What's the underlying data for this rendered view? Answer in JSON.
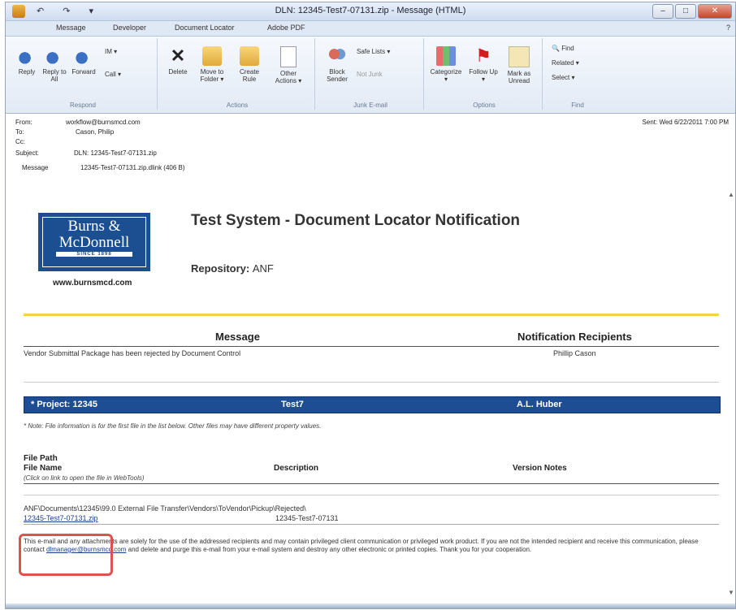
{
  "window": {
    "title": "DLN: 12345-Test7-07131.zip - Message (HTML)",
    "qat": "↶ ↷ ▾"
  },
  "ribbon_tabs": [
    "Message",
    "Developer",
    "Document Locator",
    "Adobe PDF"
  ],
  "ribbon": {
    "respond": {
      "reply": "Reply",
      "reply_all": "Reply to All",
      "forward": "Forward",
      "im": "IM ▾",
      "call": "Call ▾",
      "group": "Respond"
    },
    "actions": {
      "delete": "Delete",
      "move_to_folder": "Move to Folder ▾",
      "create_rule": "Create Rule",
      "other_actions": "Other Actions ▾",
      "group": "Actions"
    },
    "junk": {
      "block_sender": "Block Sender",
      "safe_lists": "Safe Lists ▾",
      "not_junk": "Not Junk",
      "group": "Junk E-mail"
    },
    "options": {
      "categorize": "Categorize ▾",
      "follow_up": "Follow Up ▾",
      "mark_unread": "Mark as Unread",
      "group": "Options"
    },
    "find": {
      "find": "Find",
      "related": "Related ▾",
      "select": "Select ▾",
      "group": "Find"
    }
  },
  "header": {
    "from_label": "From:",
    "from": "workflow@burnsmcd.com",
    "to_label": "To:",
    "to": "Cason, Philip",
    "cc_label": "Cc:",
    "cc": "",
    "subject_label": "Subject:",
    "subject": "DLN: 12345-Test7-07131.zip",
    "message_label": "Message",
    "attachment": "12345-Test7-07131.zip.dlink (406 B)",
    "sent": "Sent:   Wed 6/22/2011 7:00 PM"
  },
  "email": {
    "logo_line1": "Burns &",
    "logo_line2": "McDonnell",
    "logo_since": "SINCE 1898",
    "website": "www.burnsmcd.com",
    "notification_title": "Test System - Document Locator Notification",
    "repository_label": "Repository:",
    "repository": "ANF",
    "message_heading": "Message",
    "recipients_heading": "Notification Recipients",
    "message_text": "Vendor Submittal Package has been rejected by Document Control",
    "recipient": "Phillip Cason",
    "project_label": "* Project: 12345",
    "project_name": "Test7",
    "project_person": "A.L. Huber",
    "note": "* Note: File information is for the first file in the list below. Other files may have different property values.",
    "file_path_heading": "File Path",
    "file_name_heading": "File Name",
    "description_heading": "Description",
    "version_notes_heading": "Version Notes",
    "click_hint": "(Click on link to open the file in WebTools)",
    "file_path": "ANF\\Documents\\12345\\99.0 External File Transfer\\Vendors\\ToVendor\\Pickup\\Rejected\\",
    "file_name": "12345-Test7-07131.zip",
    "file_description": "12345-Test7-07131",
    "disclaimer_1": "This e-mail and any attachments are solely for the use of the addressed recipients and may contain privileged client communication or privileged work product. If you are not the intended recipient and receive this communication, please contact ",
    "disclaimer_email": "dlmanager@burnsmcd.com",
    "disclaimer_2": " and delete and purge this e-mail from your e-mail system and destroy any other electronic or printed copies. Thank you for your cooperation."
  },
  "colors": {
    "project_bar": "#1d4e93",
    "divider": "#f1d34f",
    "callout": "#d9534f"
  }
}
